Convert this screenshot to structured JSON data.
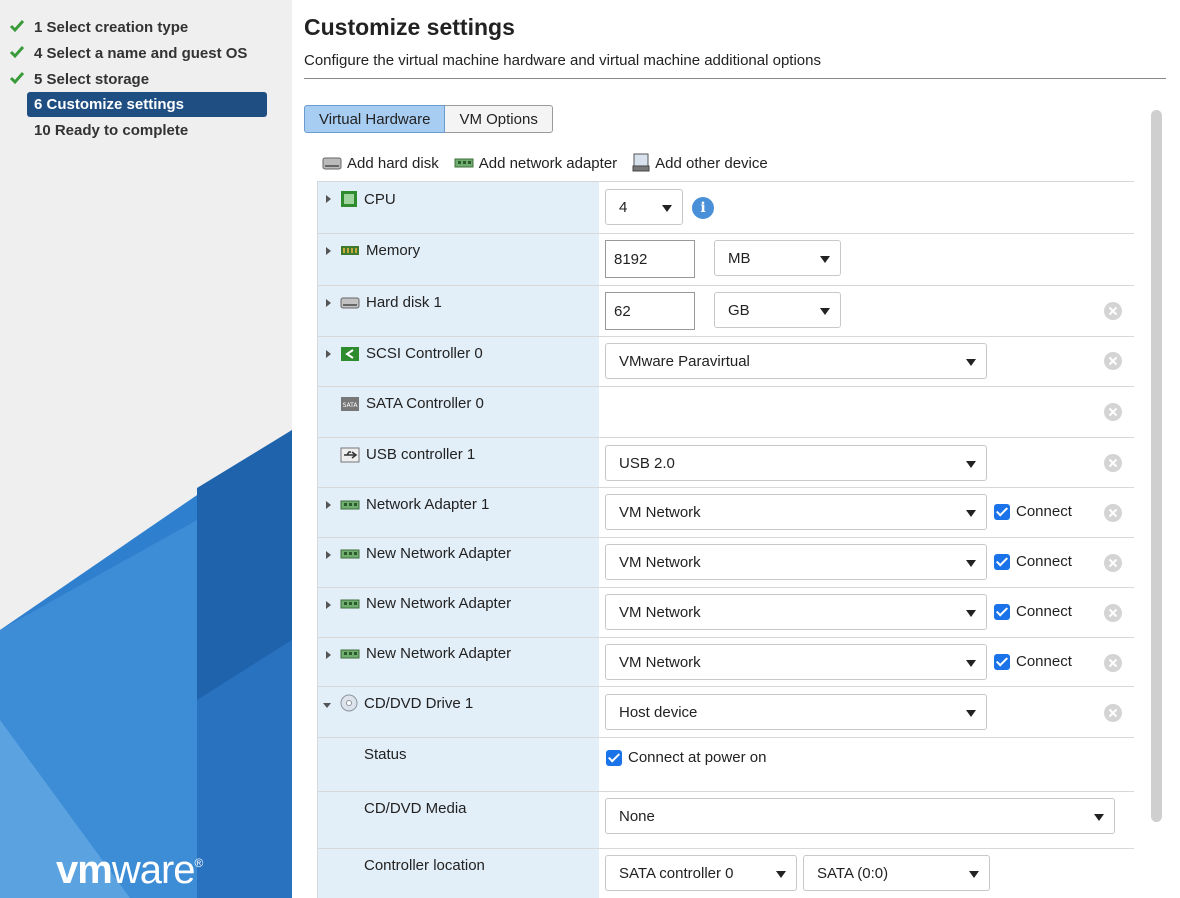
{
  "sidebar": {
    "steps": [
      {
        "label": "1 Select creation type",
        "done": true
      },
      {
        "label": "4 Select a name and guest OS",
        "done": true
      },
      {
        "label": "5 Select storage",
        "done": true
      },
      {
        "label": "6 Customize settings",
        "done": false,
        "active": true
      },
      {
        "label": "10 Ready to complete",
        "done": false
      }
    ],
    "logo_bold": "vm",
    "logo_rest": "ware",
    "logo_mark": "®"
  },
  "page": {
    "title": "Customize settings",
    "subtitle": "Configure the virtual machine hardware and virtual machine additional options"
  },
  "tabs": [
    {
      "label": "Virtual Hardware",
      "selected": true
    },
    {
      "label": "VM Options",
      "selected": false
    }
  ],
  "toolbar": {
    "add_hard_disk": "Add hard disk",
    "add_network_adapter": "Add network adapter",
    "add_other_device": "Add other device"
  },
  "hardware": {
    "cpu": {
      "label": "CPU",
      "value": "4"
    },
    "memory": {
      "label": "Memory",
      "value": "8192",
      "unit": "MB"
    },
    "hard_disk": {
      "label": "Hard disk 1",
      "value": "62",
      "unit": "GB"
    },
    "scsi": {
      "label": "SCSI Controller 0",
      "value": "VMware Paravirtual"
    },
    "sata": {
      "label": "SATA Controller 0"
    },
    "usb": {
      "label": "USB controller 1",
      "value": "USB 2.0"
    },
    "net1": {
      "label": "Network Adapter 1",
      "value": "VM Network",
      "connect": "Connect"
    },
    "net2": {
      "label": "New Network Adapter",
      "value": "VM Network",
      "connect": "Connect"
    },
    "net3": {
      "label": "New Network Adapter",
      "value": "VM Network",
      "connect": "Connect"
    },
    "net4": {
      "label": "New Network Adapter",
      "value": "VM Network",
      "connect": "Connect"
    },
    "cdrom": {
      "label": "CD/DVD Drive 1",
      "value": "Host device",
      "status_label": "Status",
      "status_value": "Connect at power on",
      "media_label": "CD/DVD Media",
      "media_value": "None",
      "location_label": "Controller location",
      "location_controller": "SATA controller 0",
      "location_port": "SATA (0:0)"
    }
  },
  "colors": {
    "active_step": "#1f4f82",
    "selected_tab": "#a8cdf2",
    "label_column": "#e2eef8",
    "check_green": "#3a9b3a"
  }
}
